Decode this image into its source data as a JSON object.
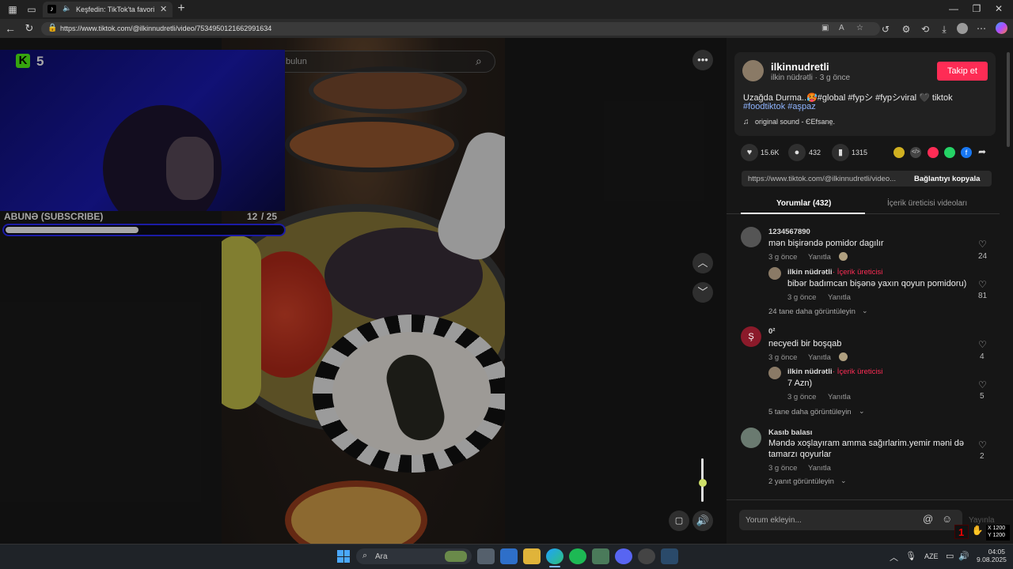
{
  "browser": {
    "tab_title": "Keşfedin: TikTok'ta favori vid...",
    "url": "https://www.tiktok.com/@ilkinnudretli/video/7534950121662991634"
  },
  "overlay": {
    "k_count": "5",
    "subscribe_label": "ABUNƏ (SUBSCRIBE)",
    "sub_current": "12",
    "sub_goal": "/ 25",
    "sub_progress": 0.48
  },
  "video": {
    "search_placeholder": "bulun"
  },
  "author": {
    "username": "ilkinnudretli",
    "display": "ilkin nüdrətli · 3 g önce",
    "follow_label": "Takip et",
    "caption_line1": "Uzağda Durma..🥵#global #fypシ #fypシviral 🖤 tiktok",
    "caption_line2": "#foodtiktok #aşpaz",
    "sound": "original sound - ЄEfsane̤."
  },
  "stats": {
    "likes": "15.6K",
    "comments": "432",
    "saves": "1315"
  },
  "share": {
    "url_preview": "https://www.tiktok.com/@ilkinnudretli/video...",
    "copy_label": "Bağlantıyı kopyala"
  },
  "tabs": {
    "comments": "Yorumlar (432)",
    "creator_videos": "İçerik üreticisi videoları"
  },
  "comments": [
    {
      "user": "1234567890",
      "text": "mən bişirəndə pomidor dagılır",
      "time": "3 g önce",
      "reply": "Yanıtla",
      "likes": "24",
      "sub": {
        "user": "ilkin nüdrətli",
        "tag": "· İçerik üreticisi",
        "text": "bibər badımcan bişənə yaxın qoyun pomidoru)",
        "time": "3 g önce",
        "reply": "Yanıtla",
        "likes": "81"
      },
      "more": "24 tane daha görüntüleyin"
    },
    {
      "user": "0²",
      "text": "necyedi bir boşqab",
      "time": "3 g önce",
      "reply": "Yanıtla",
      "likes": "4",
      "sub": {
        "user": "ilkin nüdrətli",
        "tag": "· İçerik üreticisi",
        "text": "7 Azn)",
        "time": "3 g önce",
        "reply": "Yanıtla",
        "likes": "5"
      },
      "more": "5 tane daha görüntüleyin"
    },
    {
      "user": "Kasıb balası",
      "text": "Məndə xoşlayıram amma sağırlarim.yemir məni də",
      "text2": "tamarzı qoyurlar",
      "time": "3 g önce",
      "reply": "Yanıtla",
      "likes": "2",
      "more": "2 yanıt görüntüleyin"
    }
  ],
  "comment_input": {
    "placeholder": "Yorum ekleyin...",
    "post_label": "Yayınla"
  },
  "overlay_coords": {
    "x": "X 1200",
    "y": "Y 1200"
  },
  "taskbar": {
    "search": "Ara",
    "lang": "AZE",
    "time": "04:05",
    "date": "9.08.2025"
  },
  "colors": {
    "accent": "#fe2c55",
    "progress_border": "#2a2aff"
  }
}
